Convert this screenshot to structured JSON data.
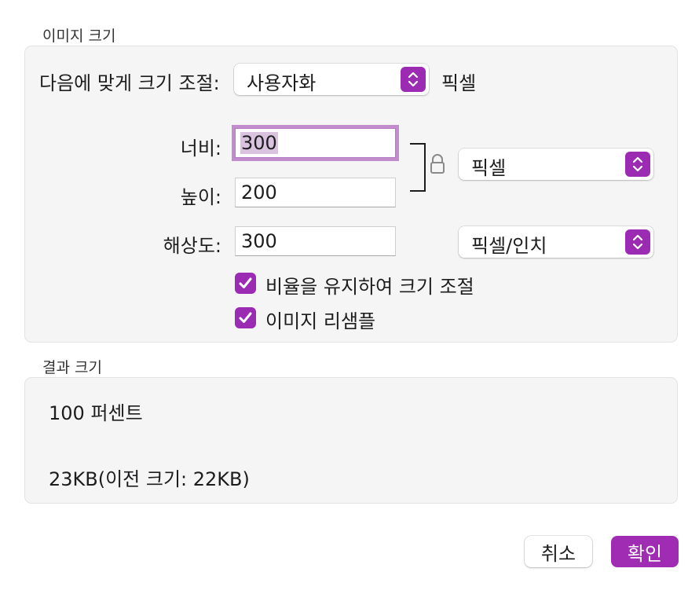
{
  "image_size": {
    "section_title": "이미지 크기",
    "fit_label": "다음에 맞게 크기 조절:",
    "fit_value": "사용자화",
    "fit_unit": "픽셀",
    "width_label": "너비:",
    "width_value": "300",
    "height_label": "높이:",
    "height_value": "200",
    "dimension_unit": "픽셀",
    "resolution_label": "해상도:",
    "resolution_value": "300",
    "resolution_unit": "픽셀/인치",
    "scale_proportionally_label": "비율을 유지하여 크기 조절",
    "scale_proportionally_checked": true,
    "resample_label": "이미지 리샘플",
    "resample_checked": true
  },
  "result": {
    "section_title": "결과 크기",
    "percent_text": "100 퍼센트",
    "size_text": "23KB(이전 크기: 22KB)"
  },
  "buttons": {
    "cancel_label": "취소",
    "ok_label": "확인"
  },
  "colors": {
    "accent": "#9b2bb2",
    "focus_ring": "#c28ccd",
    "group_background": "#f5f5f5"
  }
}
